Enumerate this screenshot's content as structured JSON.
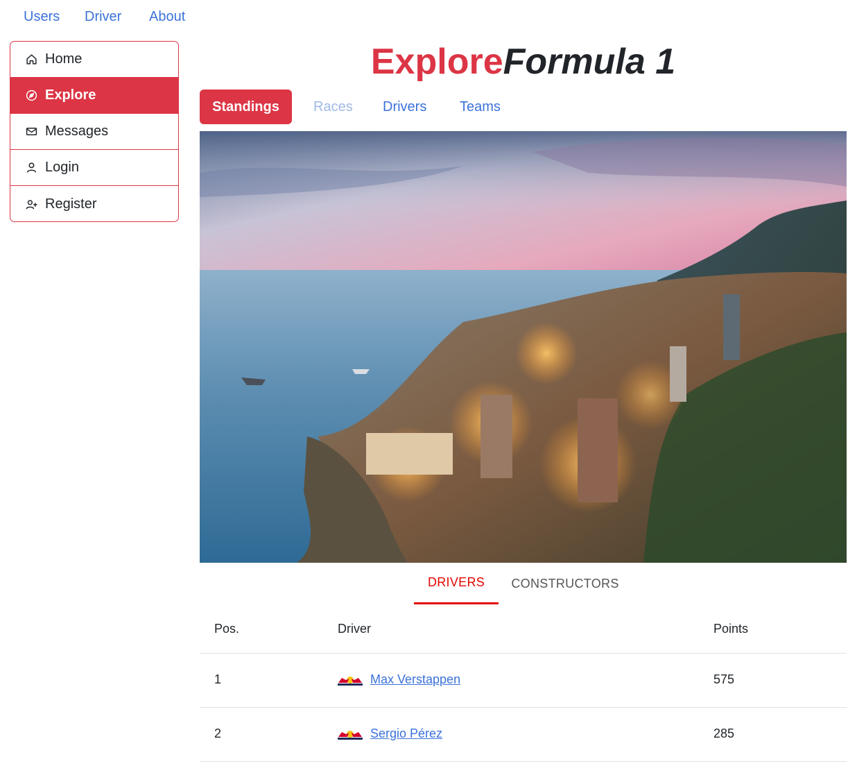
{
  "topnav": {
    "items": [
      {
        "label": "Users"
      },
      {
        "label": "Driver"
      },
      {
        "label": "About"
      }
    ]
  },
  "sidebar": {
    "items": [
      {
        "label": "Home",
        "icon": "home-icon",
        "active": false
      },
      {
        "label": "Explore",
        "icon": "compass-icon",
        "active": true
      },
      {
        "label": "Messages",
        "icon": "envelope-icon",
        "active": false
      },
      {
        "label": "Login",
        "icon": "user-icon",
        "active": false
      },
      {
        "label": "Register",
        "icon": "user-plus-icon",
        "active": false
      }
    ]
  },
  "title": {
    "part1": "Explore",
    "part2": "Formula 1"
  },
  "tabs": [
    {
      "label": "Standings",
      "state": "active"
    },
    {
      "label": "Races",
      "state": "disabled"
    },
    {
      "label": "Drivers",
      "state": "normal"
    },
    {
      "label": "Teams",
      "state": "normal"
    }
  ],
  "standings_tabs": [
    {
      "label": "DRIVERS",
      "active": true
    },
    {
      "label": "CONSTRUCTORS",
      "active": false
    }
  ],
  "table": {
    "headers": {
      "pos": "Pos.",
      "driver": "Driver",
      "points": "Points"
    },
    "rows": [
      {
        "pos": "1",
        "driver": "Max Verstappen",
        "team_logo": "red-bull-logo-icon",
        "points": "575"
      },
      {
        "pos": "2",
        "driver": "Sergio Pérez",
        "team_logo": "red-bull-logo-icon",
        "points": "285"
      }
    ]
  },
  "colors": {
    "accent": "#dc3545",
    "link": "#3b72d9",
    "tab_active": "#e10600"
  }
}
